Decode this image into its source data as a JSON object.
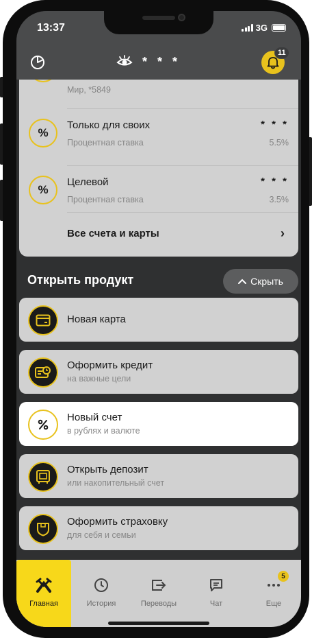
{
  "status_bar": {
    "time": "13:37",
    "network": "3G"
  },
  "header": {
    "hidden_balance": "* * *",
    "notifications_count": "11"
  },
  "accounts": {
    "partial": {
      "subtitle": "Мир, *5849"
    },
    "items": [
      {
        "name": "Только для своих",
        "amount": "* * *",
        "caption": "Процентная ставка",
        "rate": "5.5%",
        "icon": "percent-icon"
      },
      {
        "name": "Целевой",
        "amount": "* * *",
        "caption": "Процентная ставка",
        "rate": "3.5%",
        "icon": "percent-icon"
      }
    ],
    "all_label": "Все счета и карты"
  },
  "open_product": {
    "title": "Открыть продукт",
    "hide_label": "Скрыть",
    "items": [
      {
        "title": "Новая карта",
        "subtitle": "",
        "icon": "card-icon"
      },
      {
        "title": "Оформить кредит",
        "subtitle": "на важные цели",
        "icon": "credit-icon"
      },
      {
        "title": "Новый счет",
        "subtitle": "в рублях и валюте",
        "icon": "percent-icon",
        "selected": true
      },
      {
        "title": "Открыть депозит",
        "subtitle": "или накопительный счет",
        "icon": "safe-icon"
      },
      {
        "title": "Оформить страховку",
        "subtitle": "для себя и семьи",
        "icon": "shield-icon"
      }
    ]
  },
  "tabbar": {
    "items": [
      {
        "label": "Главная",
        "icon": "raiffeisen-logo-icon",
        "active": true
      },
      {
        "label": "История",
        "icon": "clock-icon"
      },
      {
        "label": "Переводы",
        "icon": "transfer-icon"
      },
      {
        "label": "Чат",
        "icon": "chat-icon"
      },
      {
        "label": "Еще",
        "icon": "more-icon",
        "badge": "5"
      }
    ]
  },
  "colors": {
    "accent": "#e8c21d",
    "card_bg": "#d1d1d1",
    "screen_bg": "#2f3031",
    "tab_active": "#f7d81a"
  }
}
